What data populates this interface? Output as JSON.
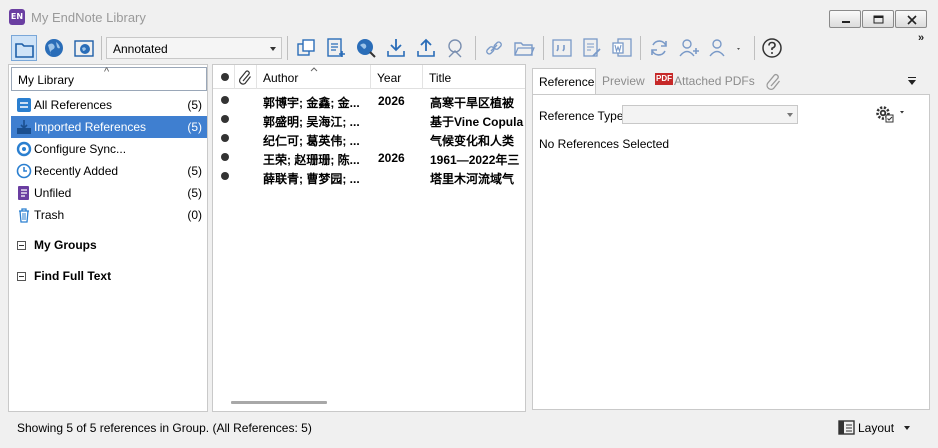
{
  "window": {
    "app_icon_text": "EN",
    "title": "My EndNote Library"
  },
  "toolbar": {
    "output_style": "Annotated",
    "more_glyph": "»"
  },
  "library": {
    "header": "My Library",
    "groups": [
      {
        "label": "All References",
        "count": "(5)",
        "icon": "all-references-icon"
      },
      {
        "label": "Imported References",
        "count": "(5)",
        "icon": "imported-references-icon"
      },
      {
        "label": "Configure Sync...",
        "count": "",
        "icon": "sync-icon"
      },
      {
        "label": "Recently Added",
        "count": "(5)",
        "icon": "clock-icon"
      },
      {
        "label": "Unfiled",
        "count": "(5)",
        "icon": "unfiled-icon"
      },
      {
        "label": "Trash",
        "count": "(0)",
        "icon": "trash-icon"
      }
    ],
    "sections": [
      {
        "label": "My Groups"
      },
      {
        "label": "Find Full Text"
      }
    ]
  },
  "reference_list": {
    "columns": {
      "author": "Author",
      "year": "Year",
      "title": "Title"
    },
    "rows": [
      {
        "author": "郭博宇; 金鑫; 金...",
        "year": "2026",
        "title": "高寒干旱区植被"
      },
      {
        "author": "郭盛明; 吴海江; ...",
        "year": "",
        "title": "基于Vine Copula"
      },
      {
        "author": "纪仁可; 葛英伟; ...",
        "year": "",
        "title": "气候变化和人类"
      },
      {
        "author": "王荣; 赵珊珊; 陈...",
        "year": "2026",
        "title": "1961—2022年三"
      },
      {
        "author": "薛联青; 曹梦园; ...",
        "year": "",
        "title": "塔里木河流域气"
      }
    ]
  },
  "reference_panel": {
    "tabs": [
      "Reference",
      "Preview",
      "Attached PDFs"
    ],
    "pdf_badge": "PDF",
    "reference_type_label": "Reference Type:",
    "reference_type_value": "",
    "empty_message": "No References Selected"
  },
  "status": {
    "text": "Showing 5 of 5 references in Group. (All References: 5)",
    "layout_label": "Layout"
  }
}
